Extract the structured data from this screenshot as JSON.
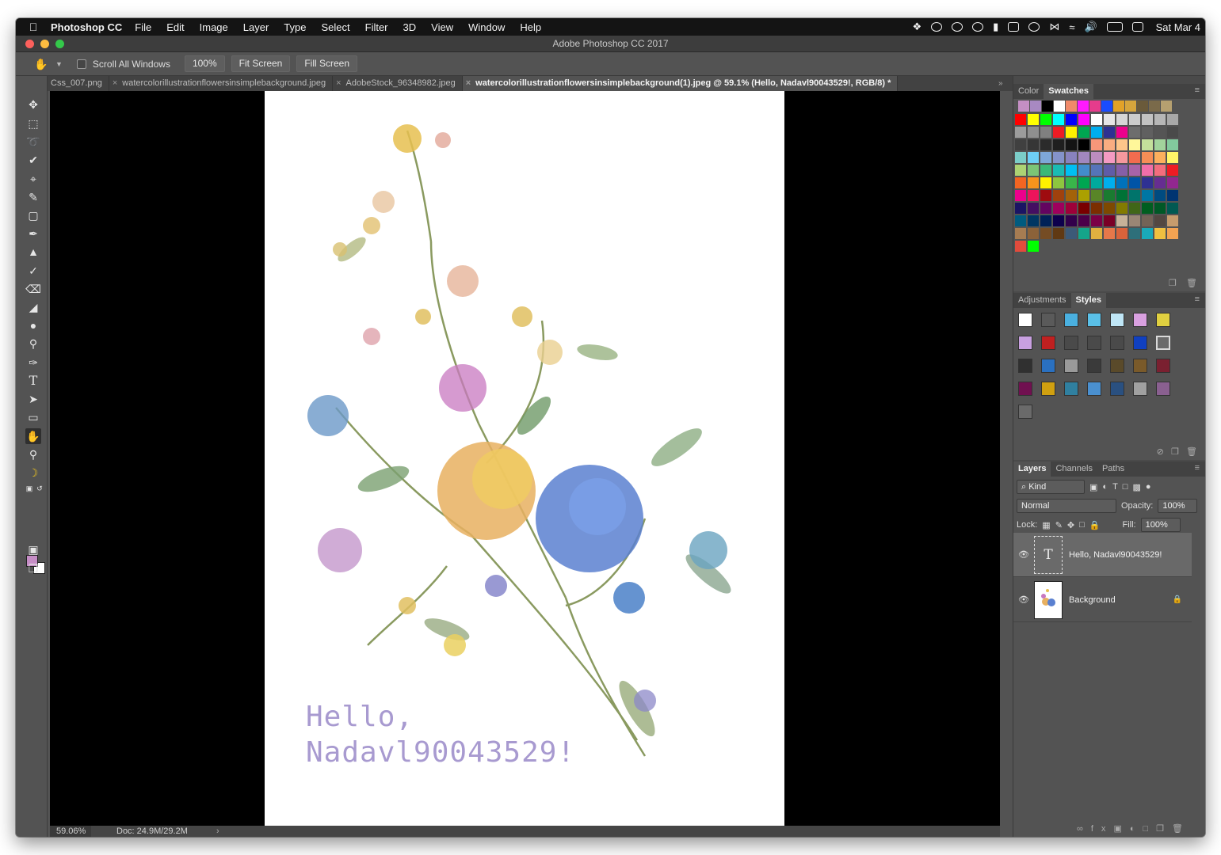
{
  "menubar": {
    "app_name": "Photoshop CC",
    "items": [
      "File",
      "Edit",
      "Image",
      "Layer",
      "Type",
      "Select",
      "Filter",
      "3D",
      "View",
      "Window",
      "Help"
    ],
    "clock": "Sat Mar 4"
  },
  "window": {
    "title": "Adobe Photoshop CC 2017"
  },
  "options": {
    "scroll_all_label": "Scroll All Windows",
    "zoom_button": "100%",
    "fit_button": "Fit Screen",
    "fill_button": "Fill Screen"
  },
  "tabs": [
    {
      "label": "Css_007.png",
      "active": false
    },
    {
      "label": "watercolorillustrationflowersinsimplebackground.jpeg",
      "active": false
    },
    {
      "label": "AdobeStock_96348982.jpeg",
      "active": false
    },
    {
      "label": "watercolorillustrationflowersinsimplebackground(1).jpeg @ 59.1% (Hello, Nadavl90043529!, RGB/8) *",
      "active": true
    }
  ],
  "canvas": {
    "greeting_line1": "Hello,",
    "greeting_line2": "Nadavl90043529!"
  },
  "status": {
    "zoom": "59.06%",
    "doc_size": "Doc: 24.9M/29.2M"
  },
  "colors": {
    "foreground": "#c68dc6",
    "background": "#ffffff"
  },
  "panels": {
    "color_tab": "Color",
    "swatches_tab": "Swatches",
    "adjustments_tab": "Adjustments",
    "styles_tab": "Styles",
    "layers_tab": "Layers",
    "channels_tab": "Channels",
    "paths_tab": "Paths",
    "kind_filter": "Kind",
    "blend_mode": "Normal",
    "opacity_label": "Opacity:",
    "opacity_value": "100%",
    "lock_label": "Lock:",
    "fill_label": "Fill:",
    "fill_value": "100%"
  },
  "layers": [
    {
      "name": "Hello, Nadavl90043529!",
      "type": "text",
      "selected": true
    },
    {
      "name": "Background",
      "type": "image",
      "locked": true
    }
  ],
  "swatches": {
    "row0": [
      "#c58fc4",
      "#a889c2",
      "#000000",
      "#ffffff",
      "#f08a6a",
      "#ff1aff",
      "#e63c8c",
      "#1a4cff",
      "#e2a228",
      "#d6a53c",
      "#6a5a3a",
      "#7a6a4a",
      "#b6a070"
    ],
    "palette": [
      [
        "#ff0000",
        "#ffff00",
        "#00ff00",
        "#00ffff",
        "#0000ff",
        "#ff00ff",
        "#ffffff",
        "#e5e5e5",
        "#d6d6d6",
        "#cccccc",
        "#c2c2c2",
        "#b6b6b6",
        "#a8a8a8"
      ],
      [
        "#9c9c9c",
        "#8f8f8f",
        "#808080",
        "#ed1c24",
        "#fff200",
        "#00a651",
        "#00aeef",
        "#2e3192",
        "#ec008c",
        "#6d6d6d",
        "#606060",
        "#555555",
        "#4a4a4a"
      ],
      [
        "#404040",
        "#363636",
        "#2b2b2b",
        "#1f1f1f",
        "#141414",
        "#000000",
        "#f7977a",
        "#f9ad81",
        "#fdc68a",
        "#fff79a",
        "#c4df9b",
        "#a2d39c",
        "#82ca9d"
      ],
      [
        "#7bcdc8",
        "#6ecff6",
        "#7ea7d8",
        "#8493ca",
        "#8882be",
        "#a187be",
        "#bc8dbf",
        "#f49ac2",
        "#f6989d",
        "#f26c4f",
        "#f68e56",
        "#fbaf5d",
        "#fff568"
      ],
      [
        "#acd373",
        "#7cc576",
        "#3bb878",
        "#1abbb4",
        "#00bff3",
        "#438ccb",
        "#5574b9",
        "#605ca8",
        "#855fa8",
        "#a763a8",
        "#f06ea9",
        "#f26d7d",
        "#ed1c24"
      ],
      [
        "#f26522",
        "#f7941d",
        "#fff200",
        "#8dc63f",
        "#39b54a",
        "#00a651",
        "#00a99d",
        "#00aeef",
        "#0072bc",
        "#0054a6",
        "#2e3192",
        "#662d91",
        "#92278f"
      ],
      [
        "#ec008c",
        "#ed145b",
        "#9e0b0f",
        "#a0410d",
        "#a36209",
        "#aba000",
        "#598527",
        "#1a7b30",
        "#007236",
        "#00746b",
        "#0076a3",
        "#004b80",
        "#003471"
      ],
      [
        "#1b1464",
        "#440e62",
        "#630460",
        "#9e005d",
        "#9e0039",
        "#790000",
        "#7b2e00",
        "#7d4900",
        "#827b00",
        "#406618",
        "#005e20",
        "#005826",
        "#005952"
      ],
      [
        "#005b7f",
        "#003663",
        "#002157",
        "#0d004c",
        "#32004b",
        "#4b0049",
        "#7b0046",
        "#7a0026",
        "#c7b299",
        "#998675",
        "#736357",
        "#534741",
        "#c69c6d"
      ],
      [
        "#a67c52",
        "#8c6239",
        "#754c24",
        "#603913",
        "#3c5a78",
        "#14a58a",
        "#e0b040",
        "#e6784a",
        "#d9633b",
        "#2e6f7a",
        "#1aa9b9",
        "#f0c040",
        "#f3a352"
      ],
      [
        "#e24b3c",
        "#00ff00"
      ]
    ]
  }
}
